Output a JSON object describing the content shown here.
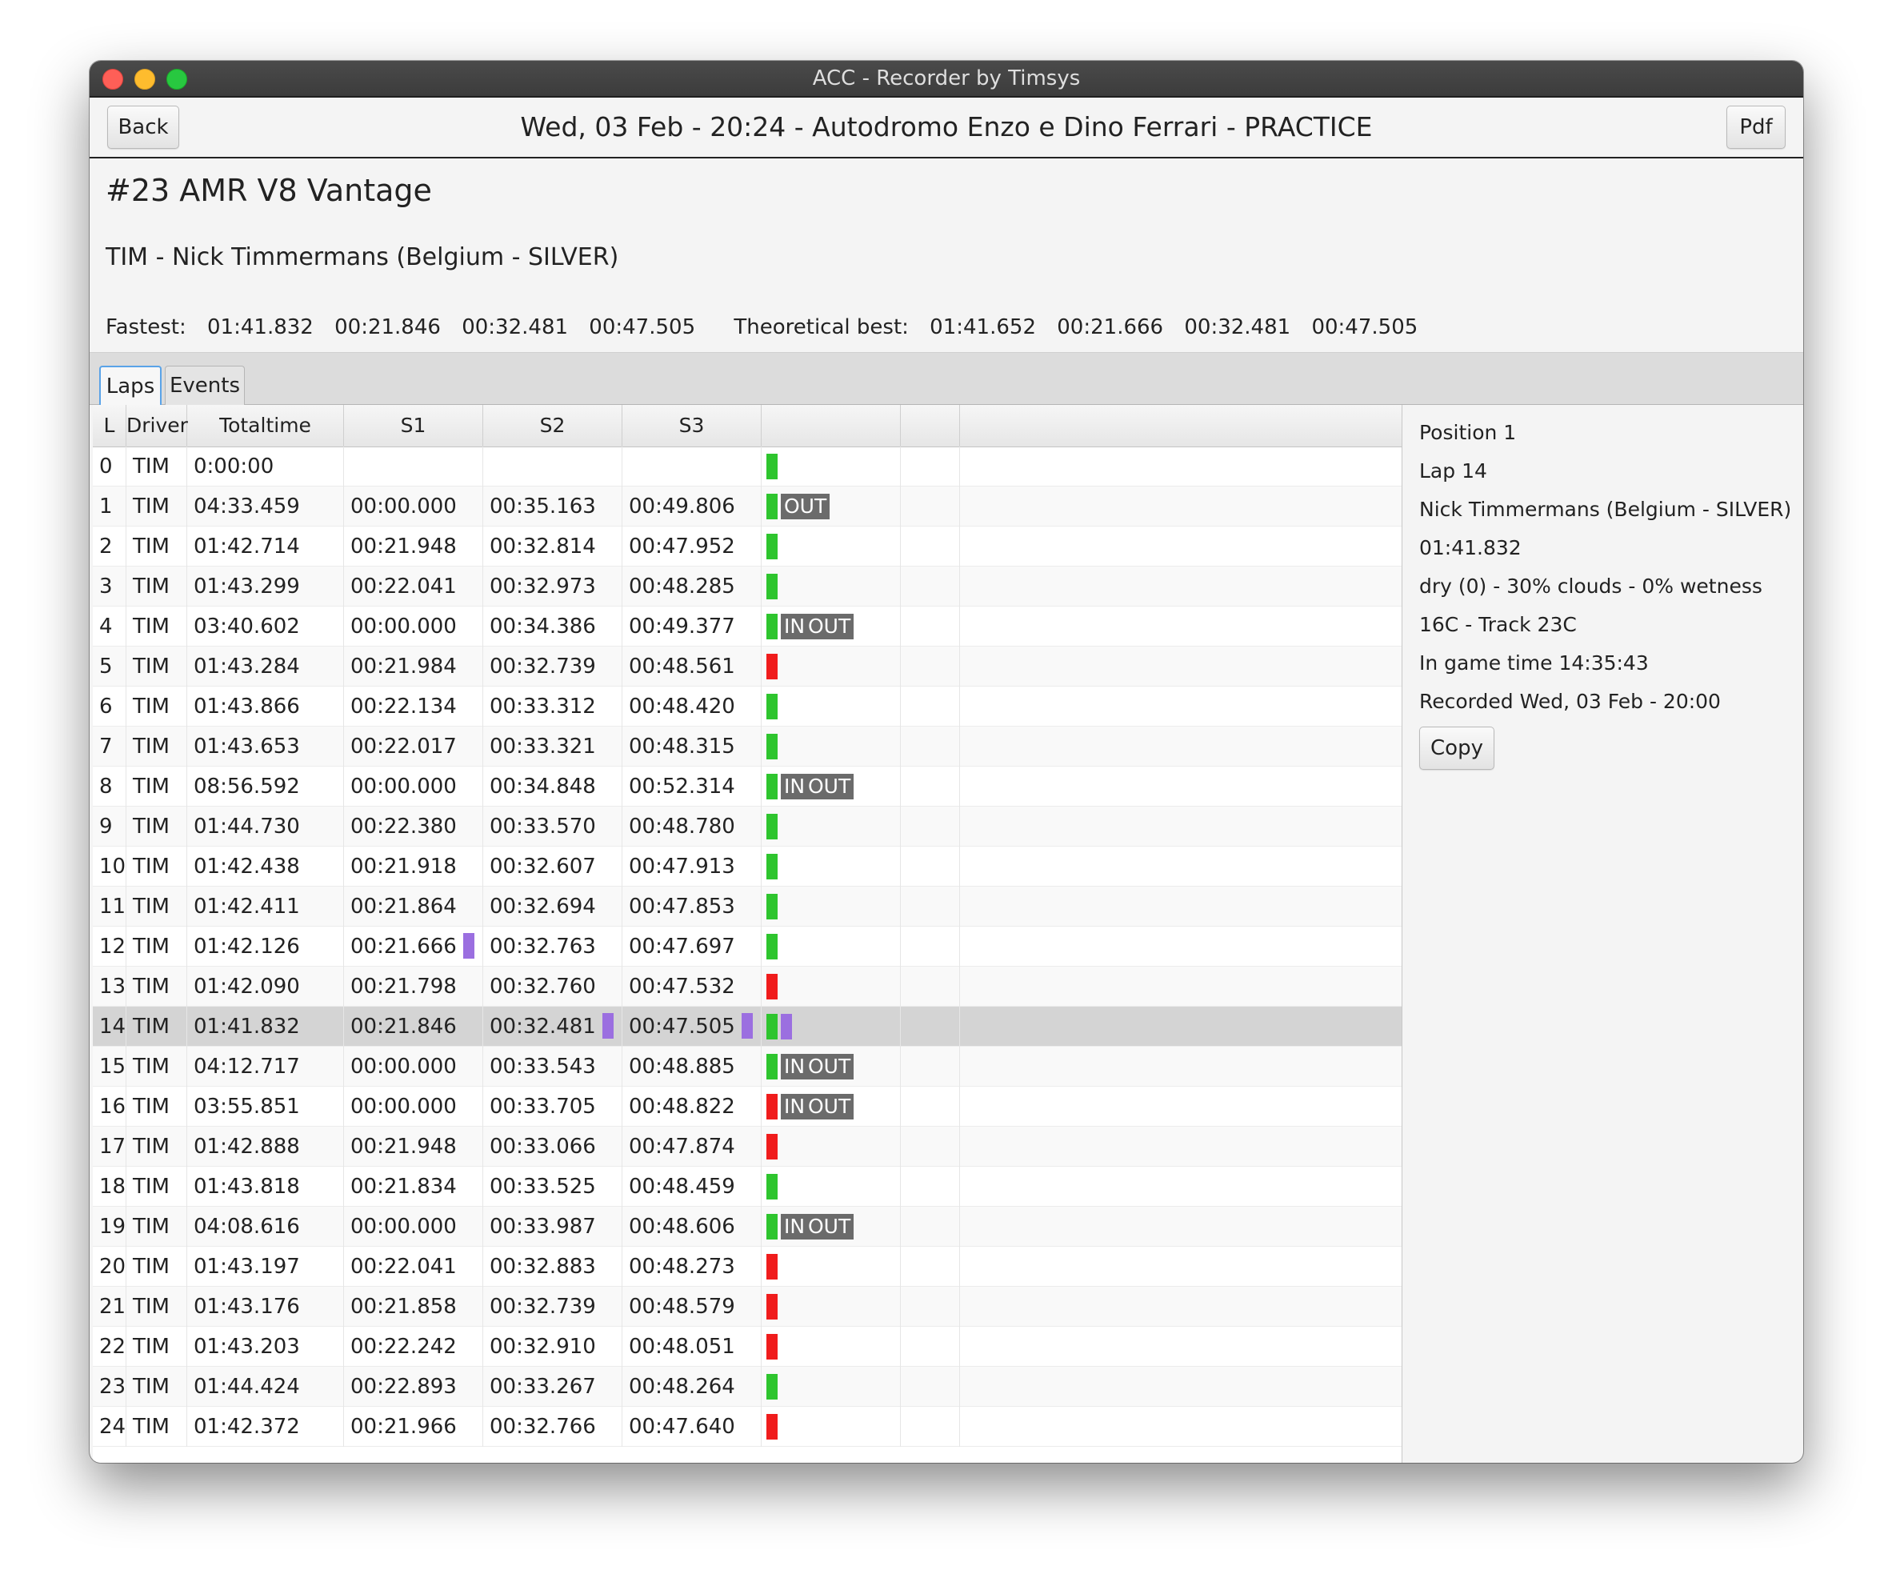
{
  "window": {
    "title": "ACC - Recorder by Timsys"
  },
  "header": {
    "back_label": "Back",
    "session_title": "Wed, 03 Feb - 20:24 - Autodromo Enzo e Dino Ferrari - PRACTICE",
    "pdf_label": "Pdf"
  },
  "car": {
    "title": "#23 AMR V8 Vantage"
  },
  "driver": {
    "line": "TIM - Nick Timmermans (Belgium - SILVER)"
  },
  "fastest": {
    "label": "Fastest:",
    "lap": "01:41.832",
    "s1": "00:21.846",
    "s2": "00:32.481",
    "s3": "00:47.505",
    "theoretical_label": "Theoretical best:",
    "t_lap": "01:41.652",
    "t_s1": "00:21.666",
    "t_s2": "00:32.481",
    "t_s3": "00:47.505"
  },
  "tabs": [
    {
      "label": "Laps",
      "active": true
    },
    {
      "label": "Events",
      "active": false
    }
  ],
  "table": {
    "columns": [
      "L",
      "Driver",
      "Totaltime",
      "S1",
      "S2",
      "S3",
      "",
      ""
    ],
    "rows": [
      {
        "l": "0",
        "driver": "TIM",
        "total": "0:00:00",
        "s1": "",
        "s2": "",
        "s3": "",
        "status": "green",
        "in": false,
        "out": false
      },
      {
        "l": "1",
        "driver": "TIM",
        "total": "04:33.459",
        "s1": "00:00.000",
        "s2": "00:35.163",
        "s3": "00:49.806",
        "status": "green",
        "in": false,
        "out": true
      },
      {
        "l": "2",
        "driver": "TIM",
        "total": "01:42.714",
        "s1": "00:21.948",
        "s2": "00:32.814",
        "s3": "00:47.952",
        "status": "green",
        "in": false,
        "out": false
      },
      {
        "l": "3",
        "driver": "TIM",
        "total": "01:43.299",
        "s1": "00:22.041",
        "s2": "00:32.973",
        "s3": "00:48.285",
        "status": "green",
        "in": false,
        "out": false
      },
      {
        "l": "4",
        "driver": "TIM",
        "total": "03:40.602",
        "s1": "00:00.000",
        "s2": "00:34.386",
        "s3": "00:49.377",
        "status": "green",
        "in": true,
        "out": true
      },
      {
        "l": "5",
        "driver": "TIM",
        "total": "01:43.284",
        "s1": "00:21.984",
        "s2": "00:32.739",
        "s3": "00:48.561",
        "status": "red",
        "in": false,
        "out": false
      },
      {
        "l": "6",
        "driver": "TIM",
        "total": "01:43.866",
        "s1": "00:22.134",
        "s2": "00:33.312",
        "s3": "00:48.420",
        "status": "green",
        "in": false,
        "out": false
      },
      {
        "l": "7",
        "driver": "TIM",
        "total": "01:43.653",
        "s1": "00:22.017",
        "s2": "00:33.321",
        "s3": "00:48.315",
        "status": "green",
        "in": false,
        "out": false
      },
      {
        "l": "8",
        "driver": "TIM",
        "total": "08:56.592",
        "s1": "00:00.000",
        "s2": "00:34.848",
        "s3": "00:52.314",
        "status": "green",
        "in": true,
        "out": true
      },
      {
        "l": "9",
        "driver": "TIM",
        "total": "01:44.730",
        "s1": "00:22.380",
        "s2": "00:33.570",
        "s3": "00:48.780",
        "status": "green",
        "in": false,
        "out": false
      },
      {
        "l": "10",
        "driver": "TIM",
        "total": "01:42.438",
        "s1": "00:21.918",
        "s2": "00:32.607",
        "s3": "00:47.913",
        "status": "green",
        "in": false,
        "out": false
      },
      {
        "l": "11",
        "driver": "TIM",
        "total": "01:42.411",
        "s1": "00:21.864",
        "s2": "00:32.694",
        "s3": "00:47.853",
        "status": "green",
        "in": false,
        "out": false
      },
      {
        "l": "12",
        "driver": "TIM",
        "total": "01:42.126",
        "s1": "00:21.666",
        "s2": "00:32.763",
        "s3": "00:47.697",
        "status": "green",
        "in": false,
        "out": false,
        "best_s1": true
      },
      {
        "l": "13",
        "driver": "TIM",
        "total": "01:42.090",
        "s1": "00:21.798",
        "s2": "00:32.760",
        "s3": "00:47.532",
        "status": "red",
        "in": false,
        "out": false
      },
      {
        "l": "14",
        "driver": "TIM",
        "total": "01:41.832",
        "s1": "00:21.846",
        "s2": "00:32.481",
        "s3": "00:47.505",
        "status": "green",
        "in": false,
        "out": false,
        "best_s2": true,
        "best_s3": true,
        "best_lap": true,
        "selected": true
      },
      {
        "l": "15",
        "driver": "TIM",
        "total": "04:12.717",
        "s1": "00:00.000",
        "s2": "00:33.543",
        "s3": "00:48.885",
        "status": "green",
        "in": true,
        "out": true
      },
      {
        "l": "16",
        "driver": "TIM",
        "total": "03:55.851",
        "s1": "00:00.000",
        "s2": "00:33.705",
        "s3": "00:48.822",
        "status": "red",
        "in": true,
        "out": true
      },
      {
        "l": "17",
        "driver": "TIM",
        "total": "01:42.888",
        "s1": "00:21.948",
        "s2": "00:33.066",
        "s3": "00:47.874",
        "status": "red",
        "in": false,
        "out": false
      },
      {
        "l": "18",
        "driver": "TIM",
        "total": "01:43.818",
        "s1": "00:21.834",
        "s2": "00:33.525",
        "s3": "00:48.459",
        "status": "green",
        "in": false,
        "out": false
      },
      {
        "l": "19",
        "driver": "TIM",
        "total": "04:08.616",
        "s1": "00:00.000",
        "s2": "00:33.987",
        "s3": "00:48.606",
        "status": "green",
        "in": true,
        "out": true
      },
      {
        "l": "20",
        "driver": "TIM",
        "total": "01:43.197",
        "s1": "00:22.041",
        "s2": "00:32.883",
        "s3": "00:48.273",
        "status": "red",
        "in": false,
        "out": false
      },
      {
        "l": "21",
        "driver": "TIM",
        "total": "01:43.176",
        "s1": "00:21.858",
        "s2": "00:32.739",
        "s3": "00:48.579",
        "status": "red",
        "in": false,
        "out": false
      },
      {
        "l": "22",
        "driver": "TIM",
        "total": "01:43.203",
        "s1": "00:22.242",
        "s2": "00:32.910",
        "s3": "00:48.051",
        "status": "red",
        "in": false,
        "out": false
      },
      {
        "l": "23",
        "driver": "TIM",
        "total": "01:44.424",
        "s1": "00:22.893",
        "s2": "00:33.267",
        "s3": "00:48.264",
        "status": "green",
        "in": false,
        "out": false
      },
      {
        "l": "24",
        "driver": "TIM",
        "total": "01:42.372",
        "s1": "00:21.966",
        "s2": "00:32.766",
        "s3": "00:47.640",
        "status": "red",
        "in": false,
        "out": false
      }
    ],
    "in_label": "IN",
    "out_label": "OUT"
  },
  "info": {
    "position": "Position 1",
    "lap": "Lap 14",
    "driver": "Nick Timmermans (Belgium - SILVER)",
    "laptime": "01:41.832",
    "weather": "dry (0) - 30% clouds - 0% wetness",
    "temps": "16C - Track 23C",
    "game_time": "In game time 14:35:43",
    "recorded": "Recorded Wed, 03 Feb - 20:00",
    "copy_label": "Copy"
  },
  "colors": {
    "green_status": "#2ec52e",
    "red_status": "#f01c1c",
    "best_sector": "#9b6fe0",
    "tag_bg": "#6b6b6b"
  }
}
